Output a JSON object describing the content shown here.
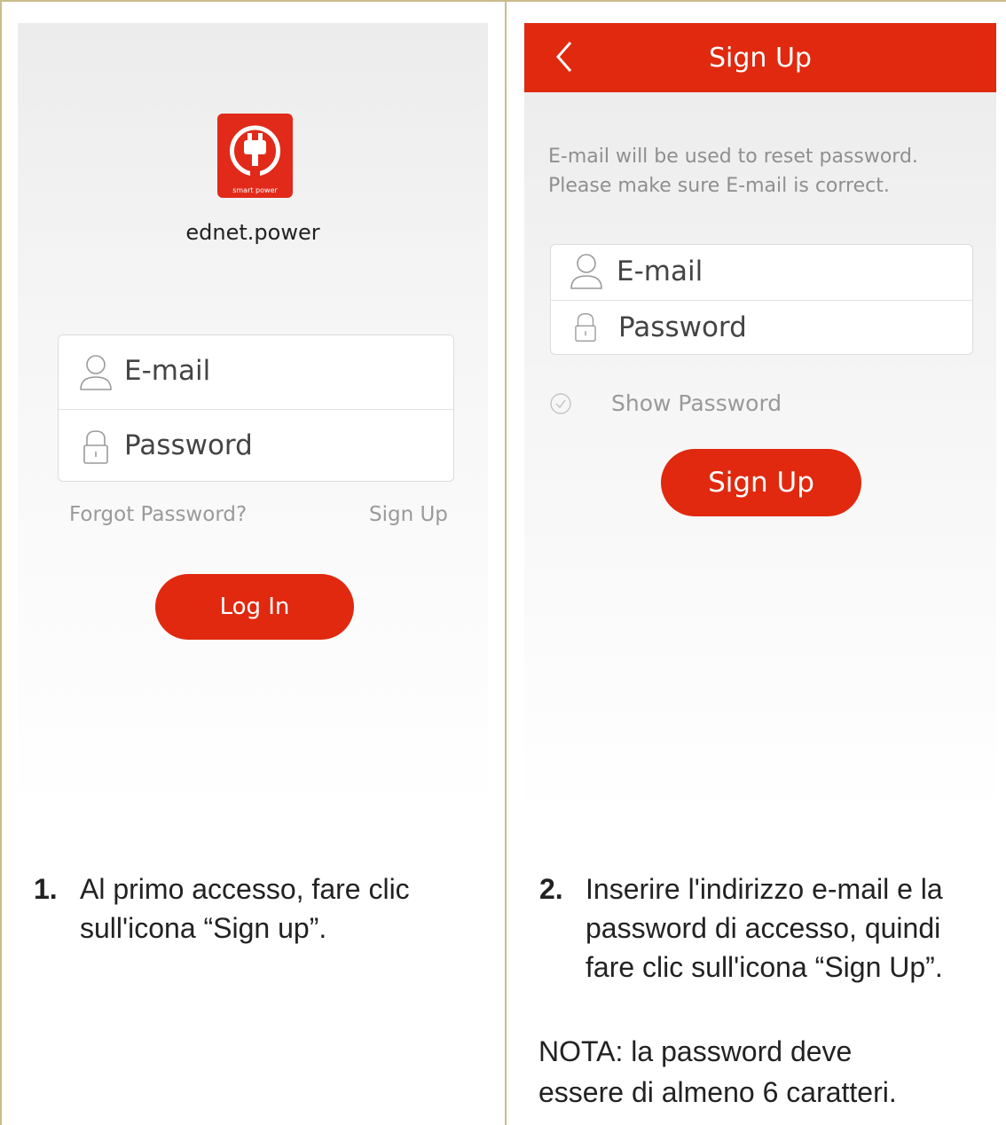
{
  "screen_login": {
    "logo_caption": "smart power",
    "app_name": "ednet.power",
    "email_placeholder": "E-mail",
    "password_placeholder": "Password",
    "forgot_password_link": "Forgot Password?",
    "sign_up_link": "Sign Up",
    "login_button": "Log In"
  },
  "screen_signup": {
    "title": "Sign Up",
    "hint": "E-mail will be used to reset password. Please make sure E-mail is correct.",
    "email_placeholder": "E-mail",
    "password_placeholder": "Password",
    "show_password_label": "Show Password",
    "signup_button": "Sign Up"
  },
  "captions": {
    "step1_number": "1.",
    "step1_line1": "Al primo accesso, fare clic",
    "step1_line2": "sull'icona “Sign up”.",
    "step2_number": "2.",
    "step2_line1": "Inserire l'indirizzo e-mail e la",
    "step2_line2": "password di accesso, quindi",
    "step2_line3": "fare clic sull'icona “Sign Up”.",
    "note_line1": "NOTA: la password deve",
    "note_line2": "essere di almeno 6 caratteri."
  },
  "colors": {
    "accent": "#e0290f",
    "frame": "#c9bc8c"
  }
}
